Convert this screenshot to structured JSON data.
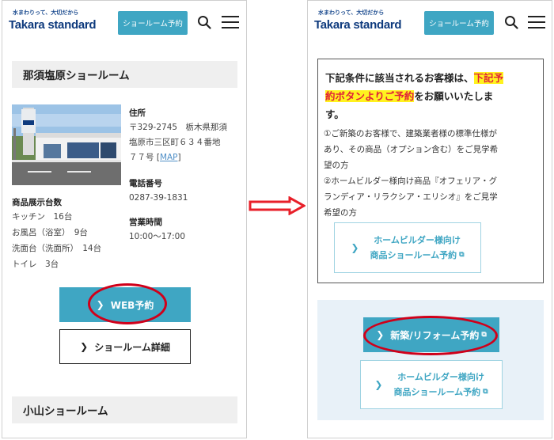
{
  "header": {
    "logo_tagline": "水まわりって、大切だから",
    "logo_name": "Takara standard",
    "reserve_label": "ショールーム予約",
    "brand_color": "#3fa6c3"
  },
  "left_screen": {
    "showroom_name": "那須塩原ショールーム",
    "address_label": "住所",
    "address_lines": [
      "〒329-2745　栃木県那須",
      "塩原市三区町６３４番地",
      "７７号 ["
    ],
    "map_label": "MAP",
    "map_close": "]",
    "phone_label": "電話番号",
    "phone_value": "0287-39-1831",
    "hours_label": "営業時間",
    "hours_value": "10:00〜17:00",
    "display_label": "商品展示台数",
    "display_items": [
      "キッチン　16台",
      "お風呂（浴室）　9台",
      "洗面台（洗面所）　14台",
      "トイレ　3台"
    ],
    "web_reserve_label": "WEB予約",
    "detail_label": "ショールーム詳細",
    "next_showroom": "小山ショールーム"
  },
  "right_screen": {
    "title_pre": "下記条件に該当されるお客様は、",
    "title_hl1": "下記予",
    "title_hl2": "約ボタンよりご予約",
    "title_post": "をお願いいたしま",
    "title_end": "す。",
    "cond1_lines": [
      "①ご新築のお客様で、建築業者様の標準仕様が",
      "あり、その商品（オプション含む）をご見学希",
      "望の方"
    ],
    "cond2_lines": [
      "②ホームビルダー様向け商品『オフェリア・グ",
      "ランディア・リラクシア・エリシオ』をご見学",
      "希望の方"
    ],
    "hb_line1": "ホームビルダー様向け",
    "hb_line2": "商品ショールーム予約",
    "reform_label": "新築/リフォーム予約"
  },
  "annotation": {
    "highlight_color": "#d0001a",
    "arrow_color": "#e8202a"
  }
}
